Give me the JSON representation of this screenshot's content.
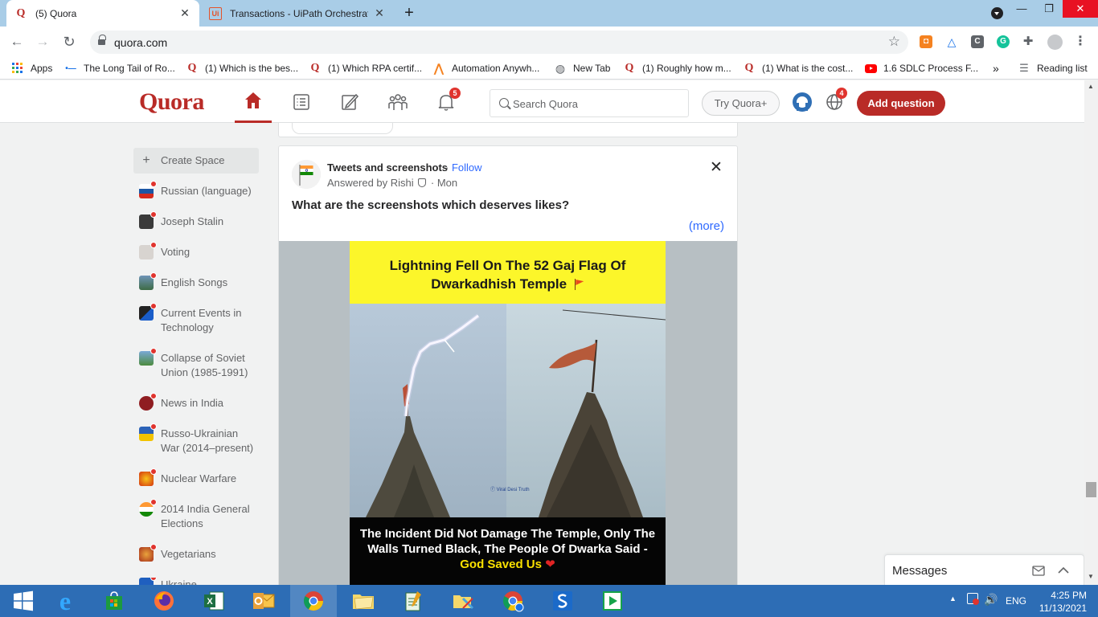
{
  "browser": {
    "tabs": [
      {
        "title": "(5) Quora",
        "favicon": "quora-q"
      },
      {
        "title": "Transactions - UiPath Orchestrato",
        "favicon": "uipath-ui"
      }
    ],
    "url": "quora.com",
    "bookmarks": [
      {
        "label": "Apps",
        "icon": "apps-grid-icon"
      },
      {
        "label": "The Long Tail of Ro...",
        "icon": "link-icon"
      },
      {
        "label": "(1) Which is the bes...",
        "icon": "quora-q"
      },
      {
        "label": "(1) Which RPA certif...",
        "icon": "quora-q"
      },
      {
        "label": "Automation Anywh...",
        "icon": "automation-anywhere-icon"
      },
      {
        "label": "New Tab",
        "icon": "globe-icon"
      },
      {
        "label": "(1) Roughly how m...",
        "icon": "quora-q"
      },
      {
        "label": "(1) What is the cost...",
        "icon": "quora-q"
      },
      {
        "label": "1.6 SDLC Process F...",
        "icon": "youtube-icon"
      }
    ],
    "more_bookmarks": "»",
    "reading_list": "Reading list"
  },
  "quora": {
    "logo": "Quora",
    "notification_count": "5",
    "language_badge": "4",
    "search_placeholder": "Search Quora",
    "try_plus": "Try Quora+",
    "add_question": "Add question",
    "brand_color": "#b92b27"
  },
  "sidebar": {
    "create_space": "Create Space",
    "items": [
      {
        "label": "Russian (language)"
      },
      {
        "label": "Joseph Stalin"
      },
      {
        "label": "Voting"
      },
      {
        "label": "English Songs"
      },
      {
        "label": "Current Events in Technology"
      },
      {
        "label": "Collapse of Soviet Union (1985-1991)"
      },
      {
        "label": "News in India"
      },
      {
        "label": "Russo-Ukrainian War (2014–present)"
      },
      {
        "label": "Nuclear Warfare"
      },
      {
        "label": "2014 India General Elections"
      },
      {
        "label": "Vegetarians"
      },
      {
        "label": "Ukraine"
      }
    ]
  },
  "post": {
    "space": "Tweets and screenshots",
    "separator": "·",
    "follow": "Follow",
    "answered_by": "Answered by Rishi",
    "day": "· Mon",
    "question": "What are the screenshots which deserves likes?",
    "more": "(more)",
    "image_headline": "Lightning Fell On The 52 Gaj Flag Of Dwarkadhish Temple",
    "image_caption": "The Incident Did Not Damage The Temple, Only The Walls Turned Black, The People Of Dwarka Said -",
    "image_caption_highlight": "God Saved Us",
    "image_watermark": "ⓕ Viral Desi Truth"
  },
  "messages": {
    "title": "Messages"
  },
  "taskbar": {
    "apps": [
      "start-icon",
      "internet-explorer-icon",
      "store-icon",
      "firefox-icon",
      "excel-icon",
      "outlook-icon",
      "chrome-icon",
      "file-explorer-icon",
      "notepad-icon",
      "folder-tool-icon",
      "chrome-profile-icon",
      "uipath-studio-icon",
      "uipath-assistant-icon"
    ],
    "language": "ENG",
    "time": "4:25 PM",
    "date": "11/13/2021"
  }
}
